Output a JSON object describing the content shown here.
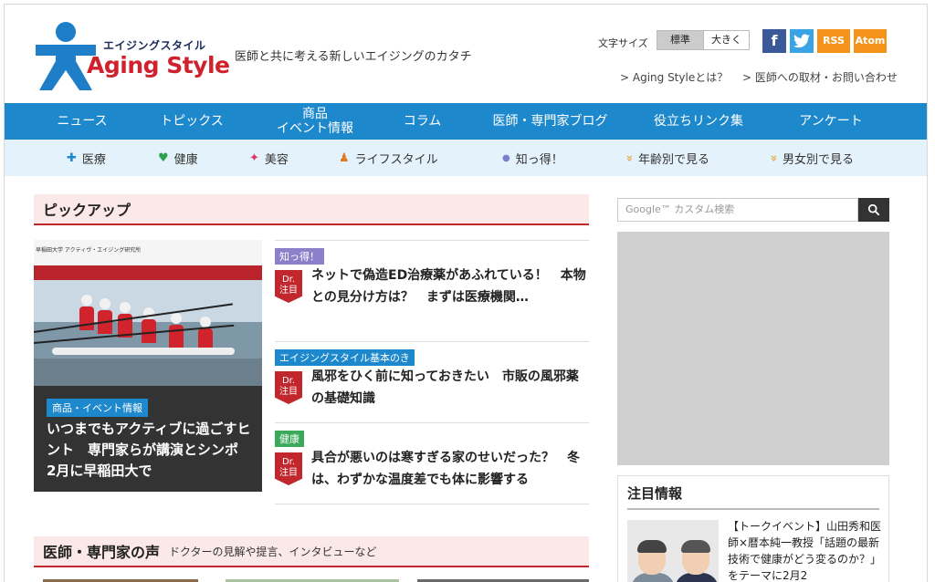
{
  "header": {
    "logo_jp": "エイジングスタイル",
    "logo_en": "Aging Style",
    "tagline": "医師と共に考える新しいエイジングのカタチ",
    "font_size_label": "文字サイズ",
    "font_size_standard": "標準",
    "font_size_large": "大きく",
    "social": {
      "facebook": "f",
      "twitter": "t",
      "rss": "RSS",
      "atom": "Atom"
    },
    "links": [
      "> Aging Styleとは？",
      "> 医師への取材・お問い合わせ"
    ]
  },
  "main_nav": [
    "ニュース",
    "トピックス",
    "商品\nイベント情報",
    "コラム",
    "医師・専門家ブログ",
    "役立ちリンク集",
    "アンケート"
  ],
  "sub_nav": [
    {
      "icon": "plus-icon",
      "glyph": "✚",
      "color": "#1e88cc",
      "label": "医療"
    },
    {
      "icon": "heart-icon",
      "glyph": "♥",
      "color": "#2aa14a",
      "label": "健康"
    },
    {
      "icon": "sparkle-icon",
      "glyph": "✦",
      "color": "#d63b6a",
      "label": "美容"
    },
    {
      "icon": "person-icon",
      "glyph": "♟",
      "color": "#e07a1f",
      "label": "ライフスタイル"
    },
    {
      "icon": "circle-icon",
      "glyph": "●",
      "color": "#7d7dd0",
      "label": "知っ得！"
    },
    {
      "icon": "double-chevron-icon",
      "glyph": "»",
      "color": "#e39a1f",
      "label": "年齢別で見る"
    },
    {
      "icon": "double-chevron-icon",
      "glyph": "»",
      "color": "#e39a1f",
      "label": "男女別で見る"
    }
  ],
  "pickup": {
    "heading": "ピックアップ",
    "feature": {
      "image_caption": "早稲田大学 アクティヴ・エイジング研究所",
      "tag": "商品・イベント情報",
      "tag_color": "#1e88cc",
      "title": "いつまでもアクティブに過ごすヒント　専門家らが講演とシンポ　2月に早稲田大で"
    },
    "articles": [
      {
        "tag": "知っ得！",
        "tag_color": "#8b80c9",
        "badge": "Dr.\n注目",
        "title": "ネットで偽造ED治療薬があふれている！　本物との見分け方は？　まずは医療機関…"
      },
      {
        "tag": "エイジングスタイル基本のき",
        "tag_color": "#1e88cc",
        "badge": "Dr.\n注目",
        "title": "風邪をひく前に知っておきたい　市販の風邪薬の基礎知識"
      },
      {
        "tag": "健康",
        "tag_color": "#3aaa5a",
        "badge": "Dr.\n注目",
        "title": "具合が悪いのは寒すぎる家のせいだった？　冬は、わずかな温度差でも体に影響する"
      }
    ]
  },
  "voice": {
    "heading": "医師・専門家の声",
    "sub": "ドクターの見解や提言、インタビューなど"
  },
  "sidebar": {
    "search_placeholder": "Google™ カスタム検索",
    "notice_heading": "注目情報",
    "notice_text": "【トークイベント】山田秀和医師×暦本純一教授「話題の最新技術で健康がどう変るのか？」をテーマに2月2"
  }
}
